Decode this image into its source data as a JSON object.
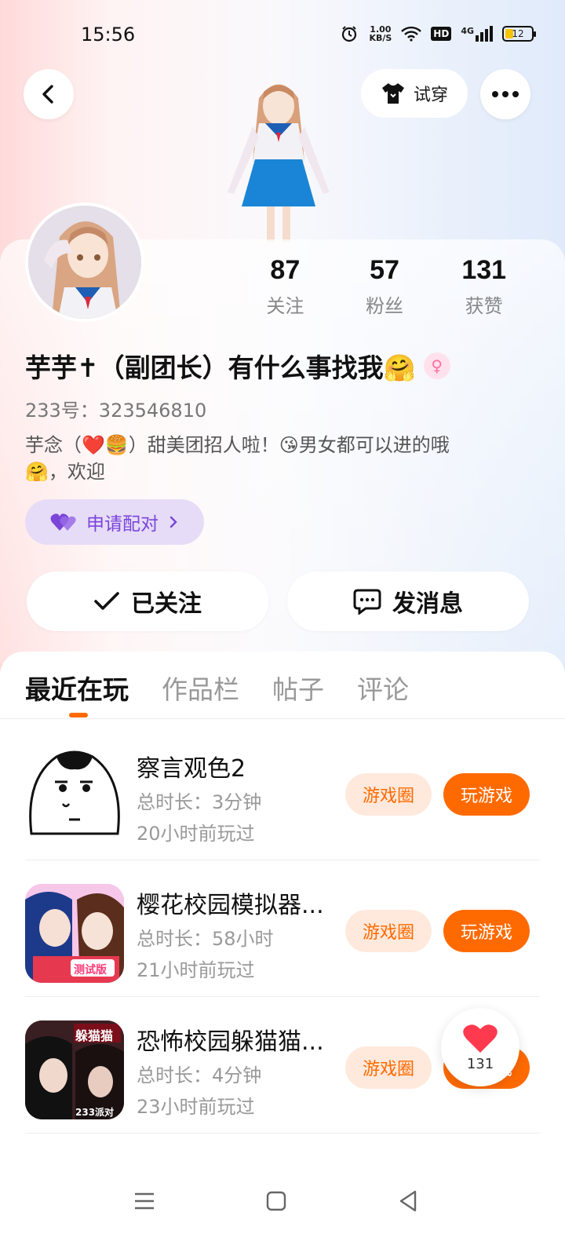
{
  "status": {
    "time": "15:56",
    "speed_top": "1.00",
    "speed_unit": "KB/S",
    "hd": "HD",
    "network": "4G",
    "battery": "12"
  },
  "header": {
    "tryon_label": "试穿"
  },
  "profile": {
    "stats": [
      {
        "value": "87",
        "label": "关注"
      },
      {
        "value": "57",
        "label": "粉丝"
      },
      {
        "value": "131",
        "label": "获赞"
      }
    ],
    "username": "芋芋✝（副团长）有什么事找我🤗",
    "gender_symbol": "♀",
    "user_id": "233号：323546810",
    "bio_line1": "芋念（❤️🍔）甜美团招人啦！😘男女都可以进的哦",
    "bio_line2": "🤗，欢迎",
    "match_label": "申请配对",
    "follow_label": "已关注",
    "message_label": "发消息"
  },
  "tabs": [
    "最近在玩",
    "作品栏",
    "帖子",
    "评论"
  ],
  "games": [
    {
      "title": "察言观色2",
      "duration": "总时长：3分钟",
      "last_played": "20小时前玩过",
      "circle_label": "游戏圈",
      "play_label": "玩游戏"
    },
    {
      "title": "樱花校园模拟器...",
      "duration": "总时长：58小时",
      "last_played": "21小时前玩过",
      "circle_label": "游戏圈",
      "play_label": "玩游戏",
      "icon_badge": "测试版"
    },
    {
      "title": "恐怖校园躲猫猫...",
      "duration": "总时长：4分钟",
      "last_played": "23小时前玩过",
      "circle_label": "游戏圈",
      "play_label": "玩游戏",
      "icon_badge": "躲猫猫",
      "icon_badge2": "233派对"
    }
  ],
  "like_fab": {
    "count": "131"
  },
  "colors": {
    "accent": "#ff6a00",
    "accent_light": "#ffe9dc",
    "match_purple": "#7a45d8"
  }
}
